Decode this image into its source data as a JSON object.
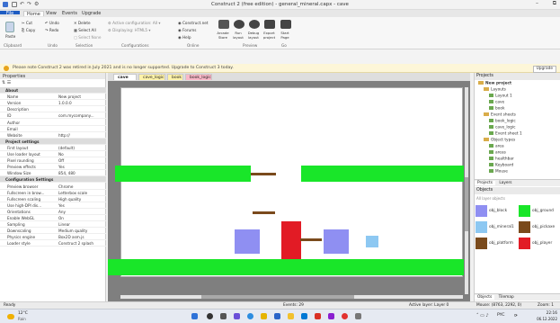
{
  "window_title": "Construct 2  (free edition) - general_mineral.capx - cave",
  "menu": [
    "File",
    "Home",
    "View",
    "Events",
    "Upgrade"
  ],
  "quick_access_icons": [
    "save-icon",
    "undo-icon",
    "redo-icon",
    "gear-icon"
  ],
  "ribbon": {
    "paste_label": "Paste",
    "clipboard_items": [
      "Cut",
      "Copy"
    ],
    "undo_items": [
      "Undo",
      "Redo"
    ],
    "selection_items": [
      "Delete",
      "Select All",
      "Select None"
    ],
    "config_items": [
      "Active configuration: All",
      "Displaying: HTML5"
    ],
    "online_items": [
      "Construct.net",
      "Forums",
      "Help"
    ],
    "preview_items": [
      "Arcade Store",
      "Run layout",
      "Debug layout",
      "Export project",
      "Start Page"
    ],
    "groups": [
      "Clipboard",
      "Undo",
      "Selection",
      "Configurations",
      "Online",
      "Preview",
      "Go"
    ]
  },
  "notice": {
    "text": "Please note Construct 2 was retired in July 2021 and is no longer supported. Upgrade to Construct 3 today.",
    "button": "Upgrade"
  },
  "properties": {
    "title": "Properties",
    "rows": [
      {
        "k": "About",
        "v": "",
        "section": true
      },
      {
        "k": "Name",
        "v": "New project"
      },
      {
        "k": "Version",
        "v": "1.0.0.0"
      },
      {
        "k": "Description",
        "v": ""
      },
      {
        "k": "ID",
        "v": "com.mycompany..."
      },
      {
        "k": "Author",
        "v": ""
      },
      {
        "k": "Email",
        "v": ""
      },
      {
        "k": "Website",
        "v": "http://"
      },
      {
        "k": "Project settings",
        "v": "",
        "section": true
      },
      {
        "k": "First layout",
        "v": "(default)"
      },
      {
        "k": "Use loader layout",
        "v": "No"
      },
      {
        "k": "Pixel rounding",
        "v": "Off"
      },
      {
        "k": "Preview effects",
        "v": "Yes"
      },
      {
        "k": "Window Size",
        "v": "854, 480"
      },
      {
        "k": "Configuration Settings",
        "v": "",
        "section": true
      },
      {
        "k": "Preview browser",
        "v": "Chrome"
      },
      {
        "k": "Fullscreen in brow...",
        "v": "Letterbox scale"
      },
      {
        "k": "Fullscreen scaling",
        "v": "High quality"
      },
      {
        "k": "Use high-DPI dis...",
        "v": "Yes"
      },
      {
        "k": "Orientations",
        "v": "Any"
      },
      {
        "k": "Enable WebGL",
        "v": "On"
      },
      {
        "k": "Sampling",
        "v": "Linear"
      },
      {
        "k": "Downscaling",
        "v": "Medium quality"
      },
      {
        "k": "Physics engine",
        "v": "Box2D asm.js"
      },
      {
        "k": "Loader style",
        "v": "Construct 2 splash"
      }
    ]
  },
  "tabs": [
    {
      "label": "cave",
      "active": true,
      "color": "#ffffff"
    },
    {
      "label": "cave_logic",
      "color": "#fff3a8"
    },
    {
      "label": "book",
      "color": "#fff3a8"
    },
    {
      "label": "book_logic",
      "color": "#f9b7c7"
    }
  ],
  "projects": {
    "title": "Projects",
    "tree": [
      {
        "label": "New project",
        "indent": 0,
        "kind": "folder",
        "bold": true
      },
      {
        "label": "Layouts",
        "indent": 1,
        "kind": "folder"
      },
      {
        "label": "Layout 1",
        "indent": 2,
        "kind": "file"
      },
      {
        "label": "cave",
        "indent": 2,
        "kind": "file"
      },
      {
        "label": "book",
        "indent": 2,
        "kind": "file"
      },
      {
        "label": "Event sheets",
        "indent": 1,
        "kind": "folder"
      },
      {
        "label": "book_logic",
        "indent": 2,
        "kind": "file"
      },
      {
        "label": "cave_logic",
        "indent": 2,
        "kind": "file"
      },
      {
        "label": "Event sheet 1",
        "indent": 2,
        "kind": "file"
      },
      {
        "label": "Object types",
        "indent": 1,
        "kind": "folder"
      },
      {
        "label": "area",
        "indent": 2,
        "kind": "file"
      },
      {
        "label": "areas",
        "indent": 2,
        "kind": "file"
      },
      {
        "label": "healthbar",
        "indent": 2,
        "kind": "file"
      },
      {
        "label": "Keyboard",
        "indent": 2,
        "kind": "file"
      },
      {
        "label": "Mouse",
        "indent": 2,
        "kind": "file"
      }
    ],
    "bottom_tabs": [
      "Projects",
      "Layers"
    ]
  },
  "objects": {
    "title": "Objects",
    "filter": "All layer objects",
    "items": [
      {
        "name": "obj_block",
        "color": "#8f8ff2"
      },
      {
        "name": "obj_ground",
        "color": "#19e629"
      },
      {
        "name": "obj_mineral1",
        "color": "#8dc8f2"
      },
      {
        "name": "obj_pickaxe",
        "color": "#7a4a1c"
      },
      {
        "name": "obj_platform",
        "color": "#7a4a1c"
      },
      {
        "name": "obj_player",
        "color": "#e21b25"
      }
    ],
    "bottom_tabs": [
      "Objects",
      "Tilemap"
    ]
  },
  "status": {
    "left": "Ready",
    "events": "Events: 29",
    "layer": "Active layer: Layer 0",
    "mouse": "Mouse: (8763, 2292, 0)",
    "zoom": "Zoom: 1"
  },
  "taskbar": {
    "weather_temp": "12°C",
    "weather_desc": "Rain",
    "tray_lang": "PYC",
    "time": "22:16",
    "date": "06.12.2022"
  },
  "accent": "#1e5cc2"
}
